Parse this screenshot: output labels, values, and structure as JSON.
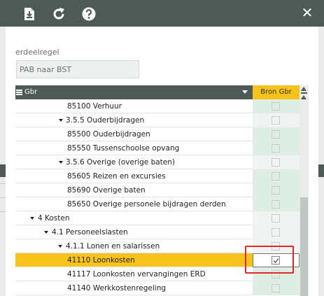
{
  "toolbar": {
    "icons": [
      "import-icon",
      "refresh-icon",
      "help-icon"
    ],
    "close_glyph": "✕"
  },
  "form": {
    "label": "erdeelregel",
    "value": "PAB naar BST"
  },
  "grid": {
    "column_title": "Gbr",
    "source_column": "Bron Gbr",
    "rows": [
      {
        "label": "85100 Verhuur",
        "type": "leaf",
        "checked": false
      },
      {
        "label": "3.5.5 Ouderbijdragen",
        "type": "group",
        "checked": false
      },
      {
        "label": "85500 Ouderbijdragen",
        "type": "leaf",
        "checked": false
      },
      {
        "label": "85550 Tussenschoolse opvang",
        "type": "leaf",
        "checked": false
      },
      {
        "label": "3.5.6 Overige (overige baten)",
        "type": "group",
        "checked": false
      },
      {
        "label": "85605 Reizen en excursies",
        "type": "leaf",
        "checked": false
      },
      {
        "label": "85690 Overige baten",
        "type": "leaf",
        "checked": false
      },
      {
        "label": "85650 Overige personele bijdragen derden",
        "type": "leaf",
        "checked": false
      },
      {
        "label": "4 Kosten",
        "type": "group",
        "checked": false
      },
      {
        "label": "4.1 Personeelslasten",
        "type": "group",
        "checked": false
      },
      {
        "label": "4.1.1 Lonen en salarissen",
        "type": "group",
        "checked": false
      },
      {
        "label": "41110 Loonkosten",
        "type": "leaf",
        "checked": true,
        "selected": true
      },
      {
        "label": "41117 Loonkosten vervangingen ERD",
        "type": "leaf",
        "checked": false
      },
      {
        "label": "41140 Werkkostenregeling",
        "type": "leaf",
        "checked": false
      }
    ]
  },
  "colors": {
    "toolbar": "#4e5a56",
    "selected_row": "#f6c31b",
    "highlight": "#e02a2a"
  }
}
